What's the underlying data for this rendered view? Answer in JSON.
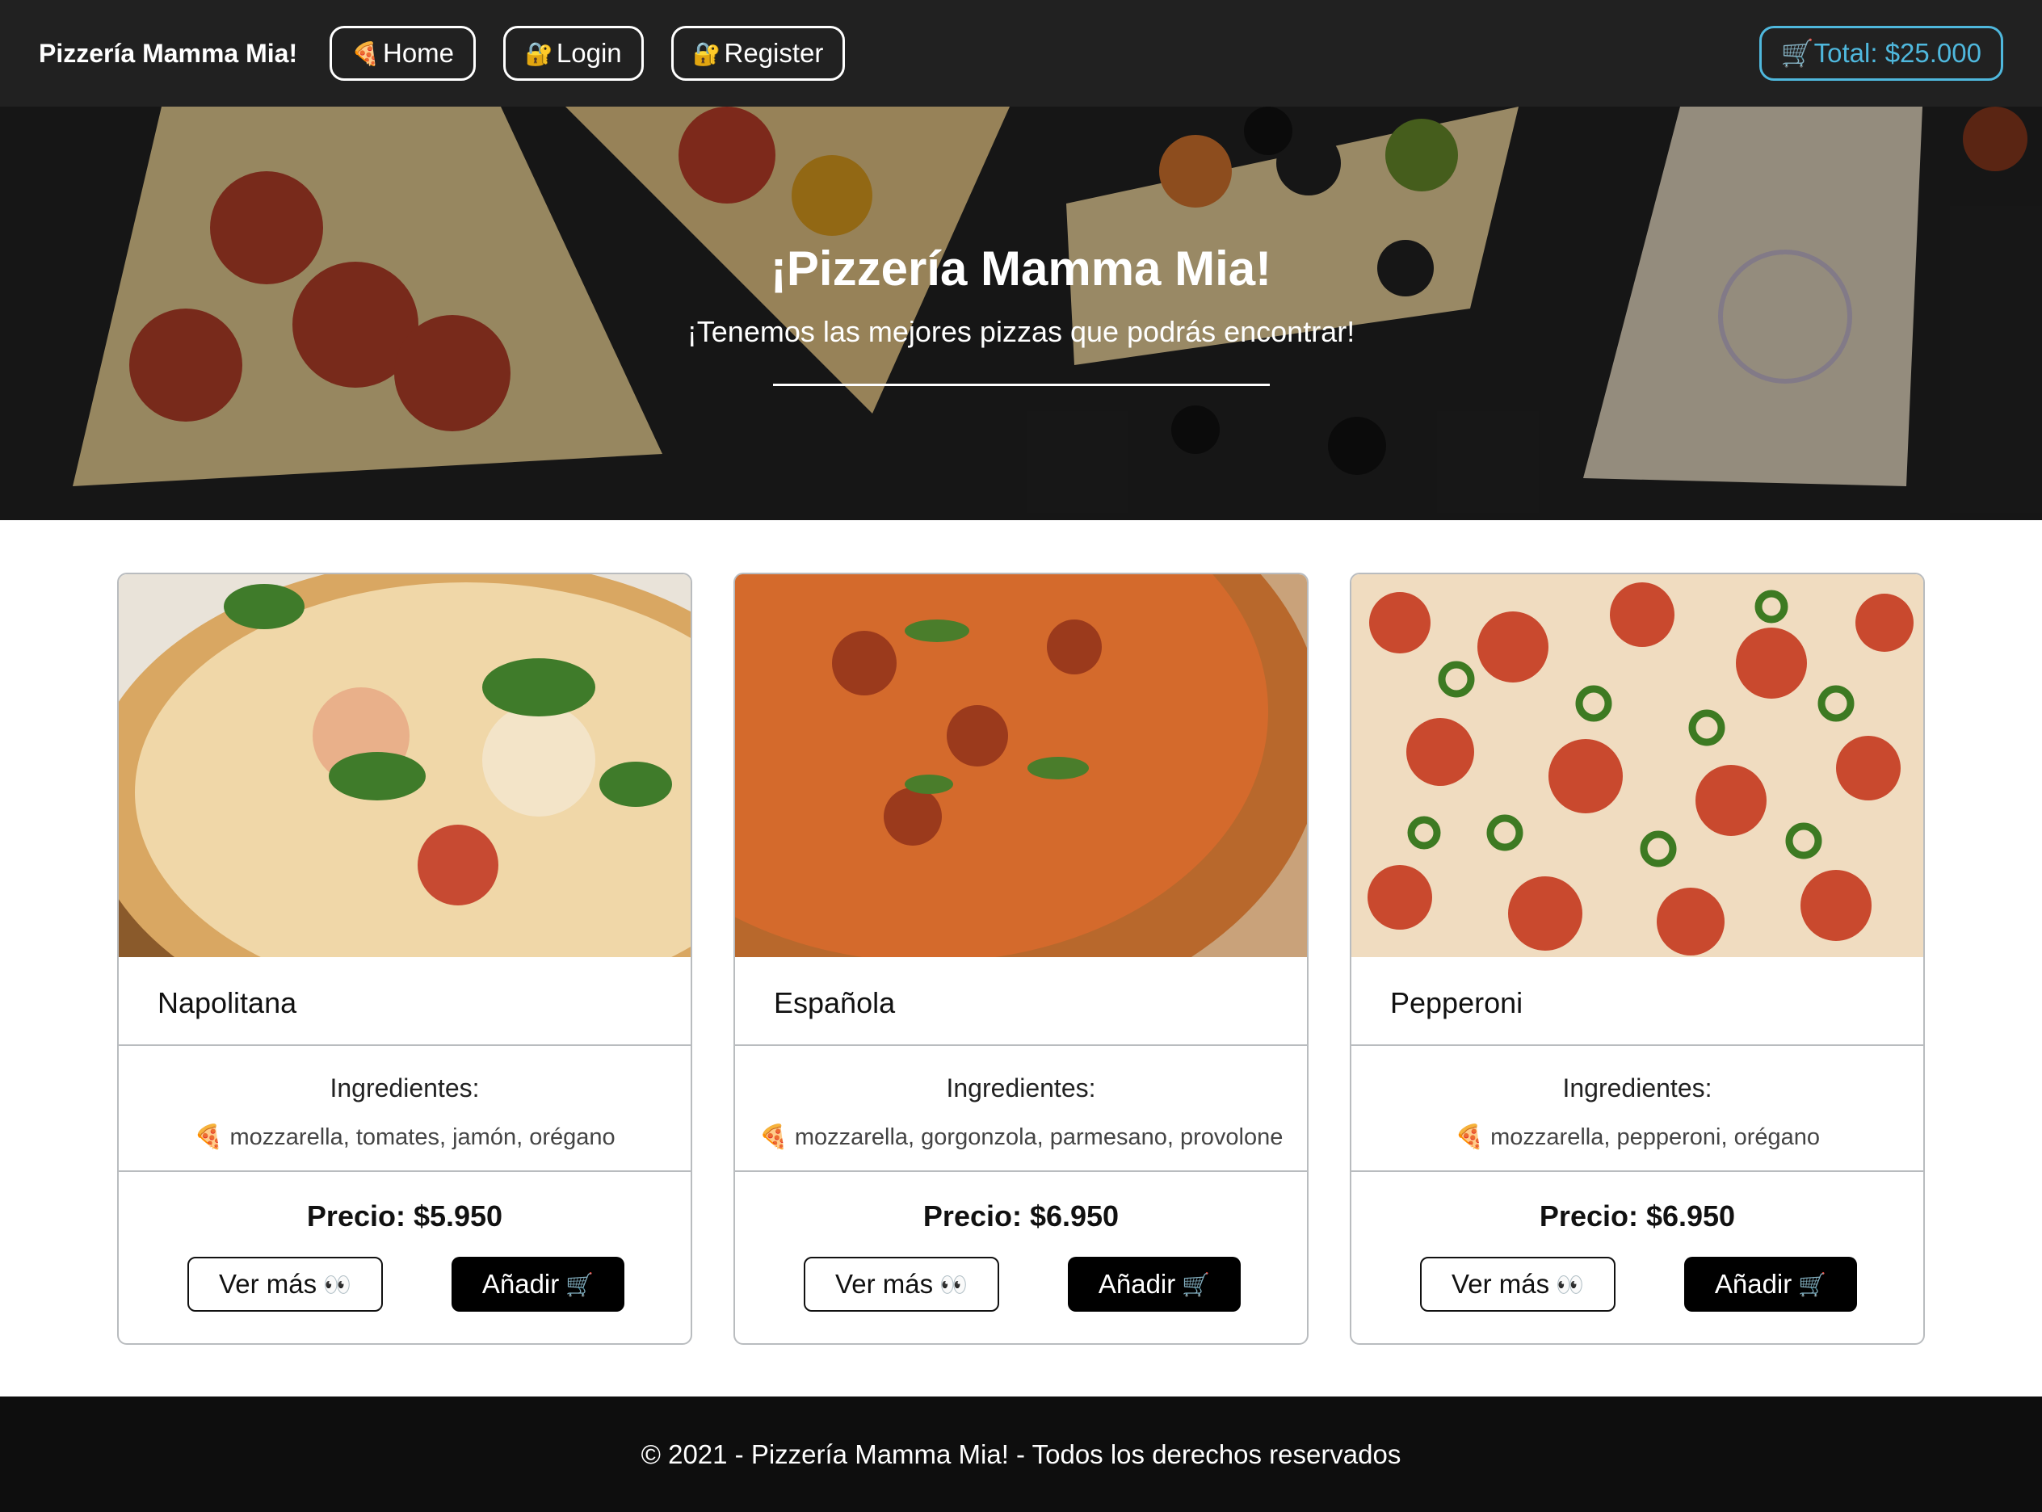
{
  "navbar": {
    "brand": "Pizzería Mamma Mia!",
    "links": [
      {
        "icon": "🍕",
        "label": "Home"
      },
      {
        "icon": "🔐",
        "label": "Login"
      },
      {
        "icon": "🔐",
        "label": "Register"
      }
    ],
    "total": {
      "icon": "🛒",
      "label": "Total: $25.000"
    },
    "colors": {
      "background": "#212121",
      "total_accent": "#4fb8dd"
    }
  },
  "hero": {
    "title": "¡Pizzería Mamma Mia!",
    "subtitle": "¡Tenemos las mejores pizzas que podrás encontrar!"
  },
  "pizzas": [
    {
      "name": "Napolitana",
      "ingredients_label": "Ingredientes:",
      "ingredients": "🍕 mozzarella, tomates, jamón, orégano",
      "price": "Precio: $5.950",
      "more_label": "Ver más",
      "more_icon": "👀",
      "add_label": "Añadir",
      "add_icon": "🛒"
    },
    {
      "name": "Española",
      "ingredients_label": "Ingredientes:",
      "ingredients": "🍕 mozzarella, gorgonzola, parmesano, provolone",
      "price": "Precio: $6.950",
      "more_label": "Ver más",
      "more_icon": "👀",
      "add_label": "Añadir",
      "add_icon": "🛒"
    },
    {
      "name": "Pepperoni",
      "ingredients_label": "Ingredientes:",
      "ingredients": "🍕 mozzarella, pepperoni, orégano",
      "price": "Precio: $6.950",
      "more_label": "Ver más",
      "more_icon": "👀",
      "add_label": "Añadir",
      "add_icon": "🛒"
    }
  ],
  "footer": {
    "text": "© 2021 - Pizzería Mamma Mia! - Todos los derechos reservados"
  }
}
